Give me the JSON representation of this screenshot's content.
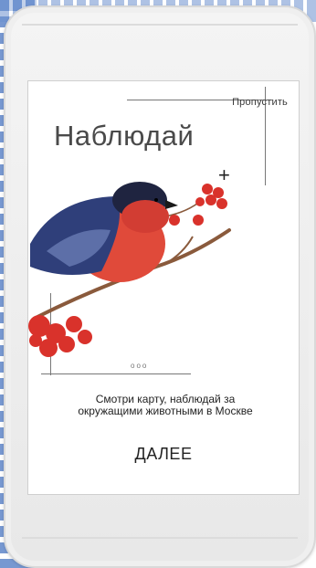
{
  "screen": {
    "skip_label": "Пропустить",
    "title": "Наблюдай",
    "plus_label": "+",
    "pager_dots": "ooo",
    "description": "Смотри карту, наблюдай за окружащими животными в Москве",
    "next_label": "ДАЛЕЕ"
  },
  "colors": {
    "bird_red": "#e04a3a",
    "bird_blue": "#2f3f7a",
    "berry_red": "#d9322b",
    "branch_brown": "#8a5a3c"
  }
}
